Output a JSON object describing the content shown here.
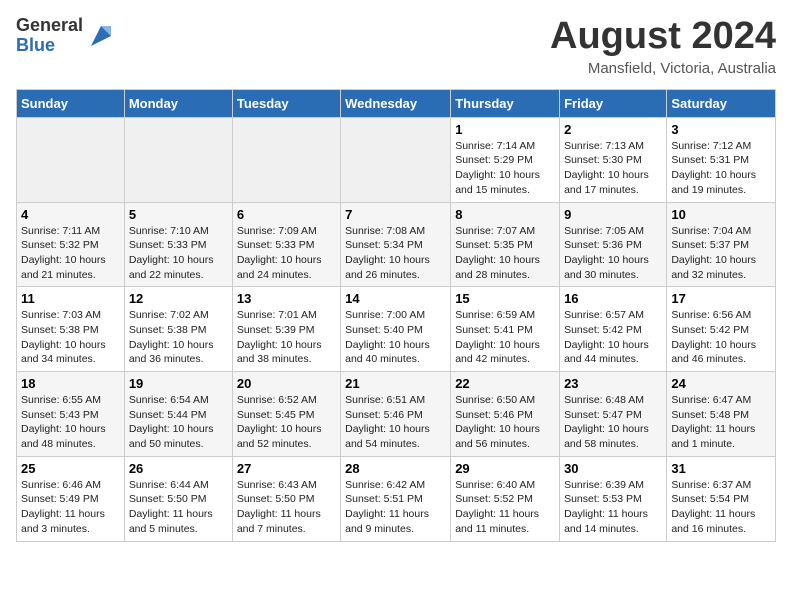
{
  "header": {
    "logo_general": "General",
    "logo_blue": "Blue",
    "month_title": "August 2024",
    "location": "Mansfield, Victoria, Australia"
  },
  "days_of_week": [
    "Sunday",
    "Monday",
    "Tuesday",
    "Wednesday",
    "Thursday",
    "Friday",
    "Saturday"
  ],
  "weeks": [
    [
      {
        "day": "",
        "info": ""
      },
      {
        "day": "",
        "info": ""
      },
      {
        "day": "",
        "info": ""
      },
      {
        "day": "",
        "info": ""
      },
      {
        "day": "1",
        "info": "Sunrise: 7:14 AM\nSunset: 5:29 PM\nDaylight: 10 hours\nand 15 minutes."
      },
      {
        "day": "2",
        "info": "Sunrise: 7:13 AM\nSunset: 5:30 PM\nDaylight: 10 hours\nand 17 minutes."
      },
      {
        "day": "3",
        "info": "Sunrise: 7:12 AM\nSunset: 5:31 PM\nDaylight: 10 hours\nand 19 minutes."
      }
    ],
    [
      {
        "day": "4",
        "info": "Sunrise: 7:11 AM\nSunset: 5:32 PM\nDaylight: 10 hours\nand 21 minutes."
      },
      {
        "day": "5",
        "info": "Sunrise: 7:10 AM\nSunset: 5:33 PM\nDaylight: 10 hours\nand 22 minutes."
      },
      {
        "day": "6",
        "info": "Sunrise: 7:09 AM\nSunset: 5:33 PM\nDaylight: 10 hours\nand 24 minutes."
      },
      {
        "day": "7",
        "info": "Sunrise: 7:08 AM\nSunset: 5:34 PM\nDaylight: 10 hours\nand 26 minutes."
      },
      {
        "day": "8",
        "info": "Sunrise: 7:07 AM\nSunset: 5:35 PM\nDaylight: 10 hours\nand 28 minutes."
      },
      {
        "day": "9",
        "info": "Sunrise: 7:05 AM\nSunset: 5:36 PM\nDaylight: 10 hours\nand 30 minutes."
      },
      {
        "day": "10",
        "info": "Sunrise: 7:04 AM\nSunset: 5:37 PM\nDaylight: 10 hours\nand 32 minutes."
      }
    ],
    [
      {
        "day": "11",
        "info": "Sunrise: 7:03 AM\nSunset: 5:38 PM\nDaylight: 10 hours\nand 34 minutes."
      },
      {
        "day": "12",
        "info": "Sunrise: 7:02 AM\nSunset: 5:38 PM\nDaylight: 10 hours\nand 36 minutes."
      },
      {
        "day": "13",
        "info": "Sunrise: 7:01 AM\nSunset: 5:39 PM\nDaylight: 10 hours\nand 38 minutes."
      },
      {
        "day": "14",
        "info": "Sunrise: 7:00 AM\nSunset: 5:40 PM\nDaylight: 10 hours\nand 40 minutes."
      },
      {
        "day": "15",
        "info": "Sunrise: 6:59 AM\nSunset: 5:41 PM\nDaylight: 10 hours\nand 42 minutes."
      },
      {
        "day": "16",
        "info": "Sunrise: 6:57 AM\nSunset: 5:42 PM\nDaylight: 10 hours\nand 44 minutes."
      },
      {
        "day": "17",
        "info": "Sunrise: 6:56 AM\nSunset: 5:42 PM\nDaylight: 10 hours\nand 46 minutes."
      }
    ],
    [
      {
        "day": "18",
        "info": "Sunrise: 6:55 AM\nSunset: 5:43 PM\nDaylight: 10 hours\nand 48 minutes."
      },
      {
        "day": "19",
        "info": "Sunrise: 6:54 AM\nSunset: 5:44 PM\nDaylight: 10 hours\nand 50 minutes."
      },
      {
        "day": "20",
        "info": "Sunrise: 6:52 AM\nSunset: 5:45 PM\nDaylight: 10 hours\nand 52 minutes."
      },
      {
        "day": "21",
        "info": "Sunrise: 6:51 AM\nSunset: 5:46 PM\nDaylight: 10 hours\nand 54 minutes."
      },
      {
        "day": "22",
        "info": "Sunrise: 6:50 AM\nSunset: 5:46 PM\nDaylight: 10 hours\nand 56 minutes."
      },
      {
        "day": "23",
        "info": "Sunrise: 6:48 AM\nSunset: 5:47 PM\nDaylight: 10 hours\nand 58 minutes."
      },
      {
        "day": "24",
        "info": "Sunrise: 6:47 AM\nSunset: 5:48 PM\nDaylight: 11 hours\nand 1 minute."
      }
    ],
    [
      {
        "day": "25",
        "info": "Sunrise: 6:46 AM\nSunset: 5:49 PM\nDaylight: 11 hours\nand 3 minutes."
      },
      {
        "day": "26",
        "info": "Sunrise: 6:44 AM\nSunset: 5:50 PM\nDaylight: 11 hours\nand 5 minutes."
      },
      {
        "day": "27",
        "info": "Sunrise: 6:43 AM\nSunset: 5:50 PM\nDaylight: 11 hours\nand 7 minutes."
      },
      {
        "day": "28",
        "info": "Sunrise: 6:42 AM\nSunset: 5:51 PM\nDaylight: 11 hours\nand 9 minutes."
      },
      {
        "day": "29",
        "info": "Sunrise: 6:40 AM\nSunset: 5:52 PM\nDaylight: 11 hours\nand 11 minutes."
      },
      {
        "day": "30",
        "info": "Sunrise: 6:39 AM\nSunset: 5:53 PM\nDaylight: 11 hours\nand 14 minutes."
      },
      {
        "day": "31",
        "info": "Sunrise: 6:37 AM\nSunset: 5:54 PM\nDaylight: 11 hours\nand 16 minutes."
      }
    ]
  ]
}
